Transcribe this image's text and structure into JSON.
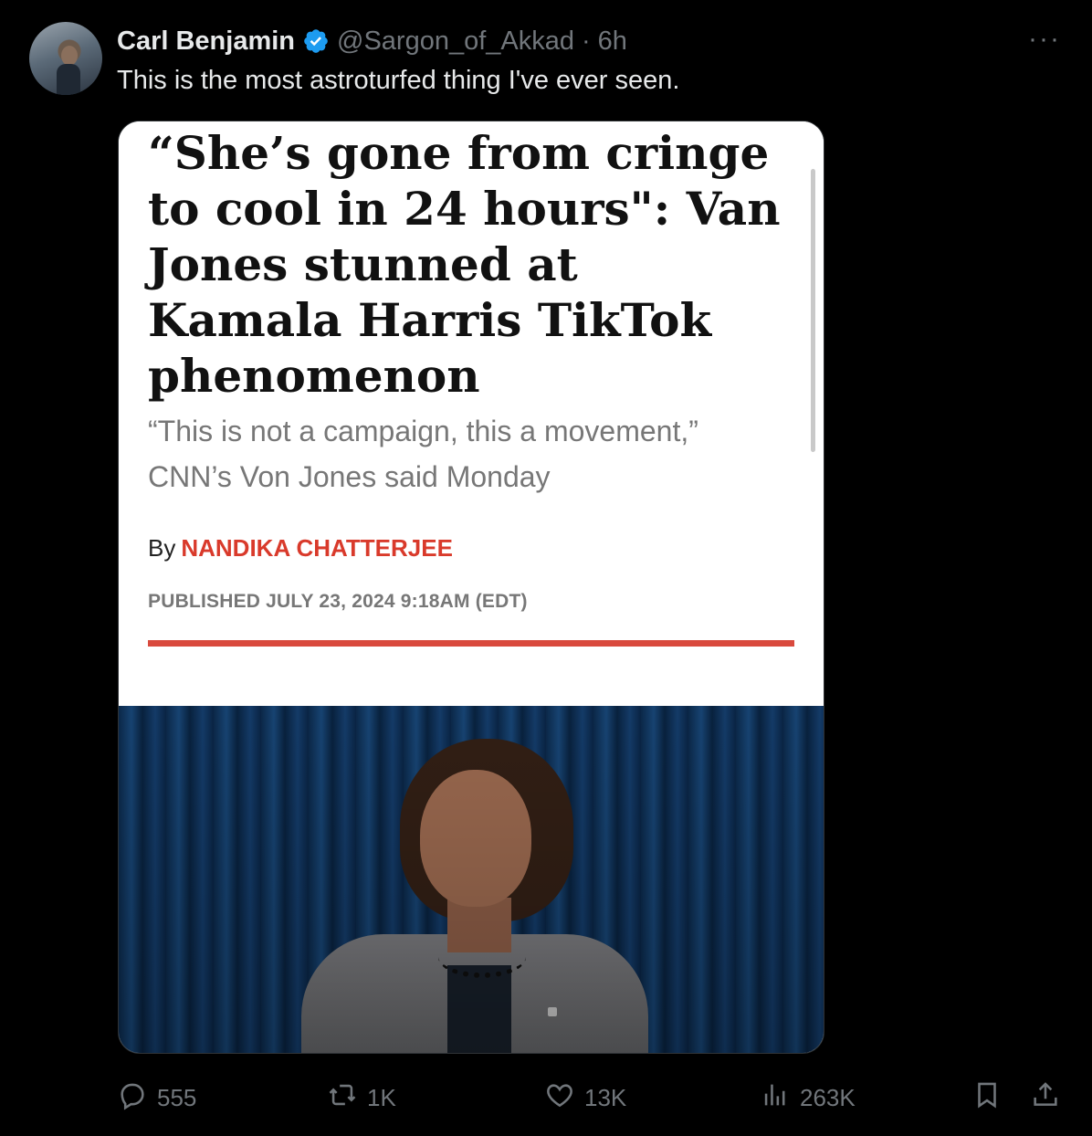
{
  "tweet": {
    "author_name": "Carl Benjamin",
    "handle": "@Sargon_of_Akkad",
    "separator": "·",
    "time": "6h",
    "text": "This is the most astroturfed thing I've ever seen.",
    "more_label": "···"
  },
  "article": {
    "headline": "“She’s gone from cringe to cool in 24 hours\": Van Jones stunned at Kamala Harris TikTok phenomenon",
    "subhead": "“This is not a campaign, this a movement,” CNN’s Von Jones said Monday",
    "by_label": "By",
    "author": "NANDIKA CHATTERJEE",
    "published": "PUBLISHED JULY 23, 2024 9:18AM (EDT)"
  },
  "actions": {
    "replies": "555",
    "reposts": "1K",
    "likes": "13K",
    "views": "263K"
  },
  "icons": [
    "verified-icon",
    "more-icon",
    "reply-icon",
    "repost-icon",
    "like-icon",
    "views-icon",
    "bookmark-icon",
    "share-icon"
  ],
  "colors": {
    "background": "#000000",
    "text_primary": "#e7e9ea",
    "text_secondary": "#71767b",
    "verified_blue": "#1d9bf0",
    "author_red": "#d93a2b"
  }
}
